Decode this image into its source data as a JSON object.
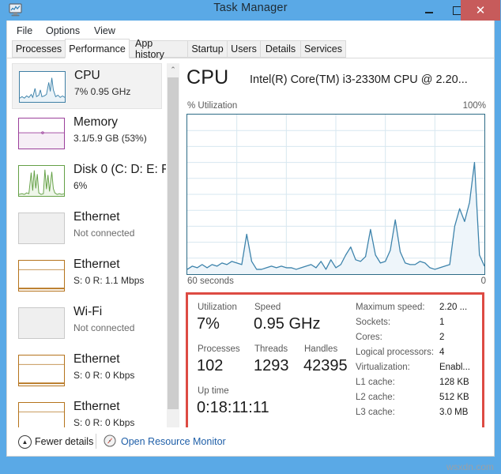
{
  "window": {
    "title": "Task Manager",
    "app_icon": "task-manager-icon",
    "minimize_label": "–",
    "maximize_label": "□",
    "close_label": "✕"
  },
  "menu": {
    "items": [
      {
        "label": "File"
      },
      {
        "label": "Options"
      },
      {
        "label": "View"
      }
    ]
  },
  "tabs": [
    {
      "label": "Processes",
      "active": false
    },
    {
      "label": "Performance",
      "active": true
    },
    {
      "label": "App history",
      "active": false
    },
    {
      "label": "Startup",
      "active": false
    },
    {
      "label": "Users",
      "active": false
    },
    {
      "label": "Details",
      "active": false
    },
    {
      "label": "Services",
      "active": false
    }
  ],
  "sidebar": {
    "items": [
      {
        "title": "CPU",
        "sub": "7%  0.95 GHz",
        "kind": "cpu",
        "selected": true,
        "dim": false
      },
      {
        "title": "Memory",
        "sub": "3.1/5.9 GB (53%)",
        "kind": "mem",
        "selected": false,
        "dim": false
      },
      {
        "title": "Disk 0 (C: D: E: F",
        "sub": "6%",
        "kind": "disk",
        "selected": false,
        "dim": false
      },
      {
        "title": "Ethernet",
        "sub": "Not connected",
        "kind": "empty",
        "selected": false,
        "dim": true
      },
      {
        "title": "Ethernet",
        "sub": "S: 0 R: 1.1 Mbps",
        "kind": "eth",
        "selected": false,
        "dim": false
      },
      {
        "title": "Wi-Fi",
        "sub": "Not connected",
        "kind": "empty",
        "selected": false,
        "dim": true
      },
      {
        "title": "Ethernet",
        "sub": "S: 0 R: 0 Kbps",
        "kind": "eth",
        "selected": false,
        "dim": false
      },
      {
        "title": "Ethernet",
        "sub": "S: 0 R: 0 Kbps",
        "kind": "eth",
        "selected": false,
        "dim": false
      }
    ],
    "scrollbar": {
      "up": "⌃",
      "down": "⌄"
    }
  },
  "main": {
    "heading": "CPU",
    "model": "Intel(R) Core(TM) i3-2330M CPU @ 2.20...",
    "y_axis_label": "% Utilization",
    "y_axis_max": "100%",
    "x_axis_left": "60 seconds",
    "x_axis_right": "0"
  },
  "chart_data": {
    "type": "area",
    "title": "% Utilization",
    "xlabel": "60 seconds",
    "ylabel": "% Utilization",
    "ylim": [
      0,
      100
    ],
    "xlim": [
      60,
      0
    ],
    "grid": true,
    "legend": null,
    "line_color": "#3d83ab",
    "fill_color": "#eef5fa",
    "grid_color": "#d7e7f0",
    "border_color": "#2d6b86",
    "x": [
      60,
      59,
      58,
      57,
      56,
      55,
      54,
      53,
      52,
      51,
      50,
      49,
      48,
      47,
      46,
      45,
      44,
      43,
      42,
      41,
      40,
      39,
      38,
      37,
      36,
      35,
      34,
      33,
      32,
      31,
      30,
      29,
      28,
      27,
      26,
      25,
      24,
      23,
      22,
      21,
      20,
      19,
      18,
      17,
      16,
      15,
      14,
      13,
      12,
      11,
      10,
      9,
      8,
      7,
      6,
      5,
      4,
      3,
      2,
      1,
      0
    ],
    "values": [
      3,
      5,
      4,
      6,
      4,
      6,
      5,
      7,
      6,
      8,
      7,
      6,
      25,
      8,
      3,
      3,
      4,
      5,
      4,
      5,
      4,
      4,
      3,
      4,
      5,
      6,
      4,
      8,
      3,
      9,
      4,
      6,
      12,
      17,
      9,
      8,
      11,
      28,
      12,
      7,
      8,
      15,
      34,
      14,
      7,
      6,
      6,
      8,
      7,
      4,
      3,
      4,
      5,
      6,
      30,
      41,
      33,
      45,
      70,
      12,
      5
    ]
  },
  "stats": {
    "utilization_label": "Utilization",
    "utilization_value": "7%",
    "speed_label": "Speed",
    "speed_value": "0.95 GHz",
    "processes_label": "Processes",
    "processes_value": "102",
    "threads_label": "Threads",
    "threads_value": "1293",
    "handles_label": "Handles",
    "handles_value": "42395",
    "uptime_label": "Up time",
    "uptime_value": "0:18:11:11",
    "highlight_color": "#dd4b43",
    "specs": [
      {
        "label": "Maximum speed:",
        "value": "2.20 ..."
      },
      {
        "label": "Sockets:",
        "value": "1"
      },
      {
        "label": "Cores:",
        "value": "2"
      },
      {
        "label": "Logical processors:",
        "value": "4"
      },
      {
        "label": "Virtualization:",
        "value": "Enabl..."
      },
      {
        "label": "L1 cache:",
        "value": "128 KB"
      },
      {
        "label": "L2 cache:",
        "value": "512 KB"
      },
      {
        "label": "L3 cache:",
        "value": "3.0 MB"
      }
    ]
  },
  "statusbar": {
    "fewer_details": "Fewer details",
    "fewer_icon": "chevron-up-circle-icon",
    "resource_monitor": "Open Resource Monitor",
    "resource_icon": "resource-monitor-icon"
  },
  "watermark": "wsxdn.com"
}
